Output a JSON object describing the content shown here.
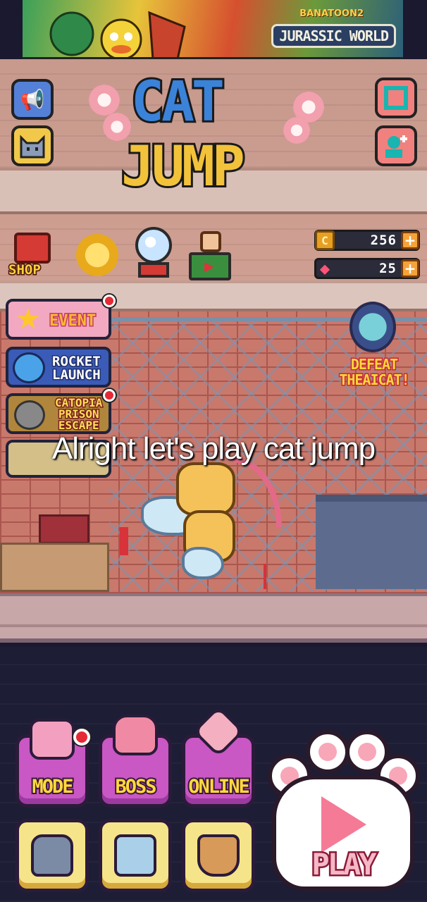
{
  "ad_banner": {
    "publisher": "BANATOON2",
    "title": "JURASSIC WORLD"
  },
  "game": {
    "logo_line1": "CAT",
    "logo_line2": "JUMP"
  },
  "top_buttons": {
    "left": [
      {
        "name": "announcement",
        "icon": "megaphone-icon"
      },
      {
        "name": "profile",
        "icon": "cat-face-icon"
      }
    ],
    "right": [
      {
        "name": "screenshot",
        "icon": "frame-icon"
      },
      {
        "name": "friends",
        "icon": "add-friend-icon"
      }
    ]
  },
  "shop_row": {
    "shop_label": "SHOP",
    "items": [
      {
        "name": "shop",
        "icon": "treasure-chest-icon"
      },
      {
        "name": "medal",
        "icon": "medal-icon"
      },
      {
        "name": "gacha",
        "icon": "gacha-machine-icon"
      },
      {
        "name": "watch-video",
        "icon": "video-reward-icon"
      }
    ]
  },
  "currencies": {
    "coins": {
      "icon_label": "C",
      "value": "256",
      "plus": "+"
    },
    "gems": {
      "icon_label": "◆",
      "value": "25",
      "plus": "+"
    }
  },
  "events": {
    "event_label": "EVENT",
    "rocket_line1": "ROCKET",
    "rocket_line2": "LAUNCH",
    "prison_line1": "CATOPIA",
    "prison_line2": "PRISON",
    "prison_line3": "ESCAPE"
  },
  "defeat_badge": {
    "line1": "DEFEAT",
    "line2": "THEAICAT!"
  },
  "caption": "Alright let's play cat jump",
  "bottom_menu": {
    "mode_label": "MODE",
    "boss_label": "BOSS",
    "online_label": "ONLINE",
    "play_label": "PLAY",
    "icons": [
      "game-console-icon",
      "boss-cat-icon",
      "crossed-swords-icon",
      "cat-collection-icon",
      "building-icon",
      "basket-icon"
    ]
  },
  "colors": {
    "accent_pink": "#f57a96",
    "button_purple": "#c957c4",
    "button_yellow": "#f6e48a",
    "notification_red": "#e52a35"
  }
}
